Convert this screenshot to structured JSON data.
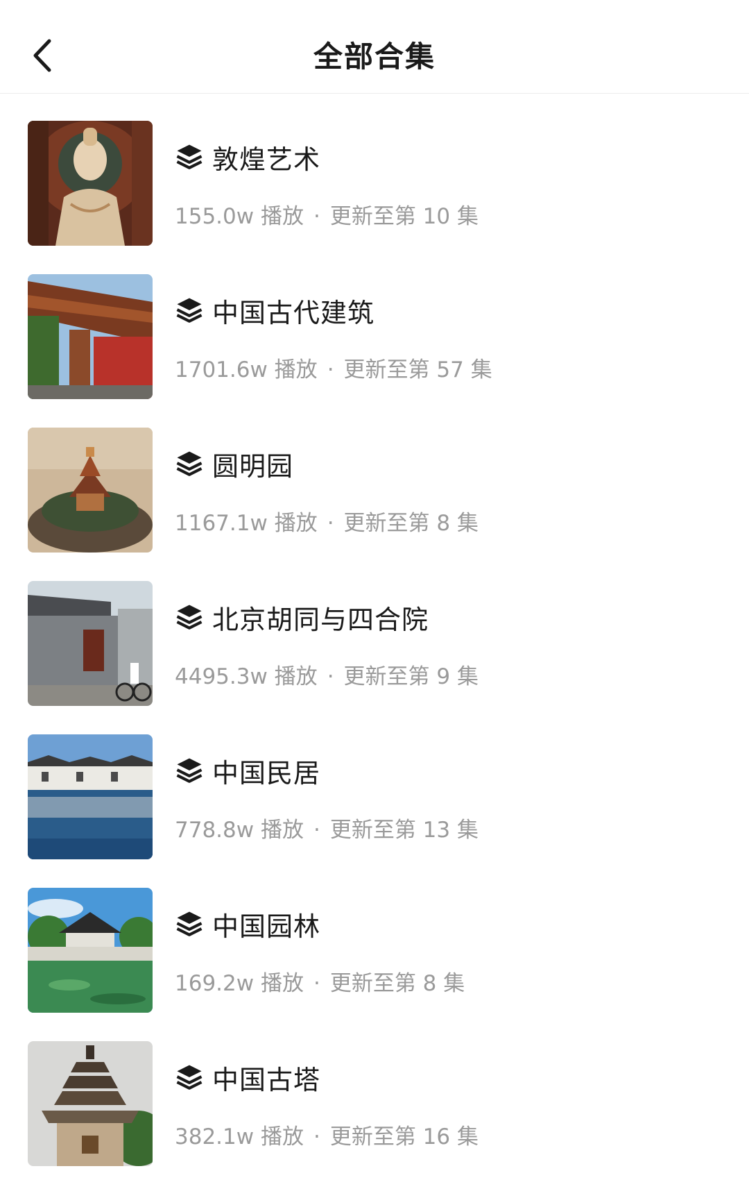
{
  "header": {
    "title": "全部合集",
    "back_icon": "chevron-left-icon"
  },
  "items": [
    {
      "name": "敦煌艺术",
      "plays": "155.0w 播放",
      "update": "更新至第 10 集",
      "thumb": "buddha-statue"
    },
    {
      "name": "中国古代建筑",
      "plays": "1701.6w 播放",
      "update": "更新至第 57 集",
      "thumb": "temple-eaves"
    },
    {
      "name": "圆明园",
      "plays": "1167.1w 播放",
      "update": "更新至第 8 集",
      "thumb": "pavilion-model"
    },
    {
      "name": "北京胡同与四合院",
      "plays": "4495.3w 播放",
      "update": "更新至第 9 集",
      "thumb": "hutong-courtyard"
    },
    {
      "name": "中国民居",
      "plays": "778.8w 播放",
      "update": "更新至第 13 集",
      "thumb": "waterside-village"
    },
    {
      "name": "中国园林",
      "plays": "169.2w 播放",
      "update": "更新至第 8 集",
      "thumb": "garden-pavilion"
    },
    {
      "name": "中国古塔",
      "plays": "382.1w 播放",
      "update": "更新至第 16 集",
      "thumb": "ancient-pagoda"
    }
  ],
  "separator": "·",
  "colors": {
    "title": "#1a1a1a",
    "meta": "#9a9a9a",
    "divider": "#ececec"
  }
}
